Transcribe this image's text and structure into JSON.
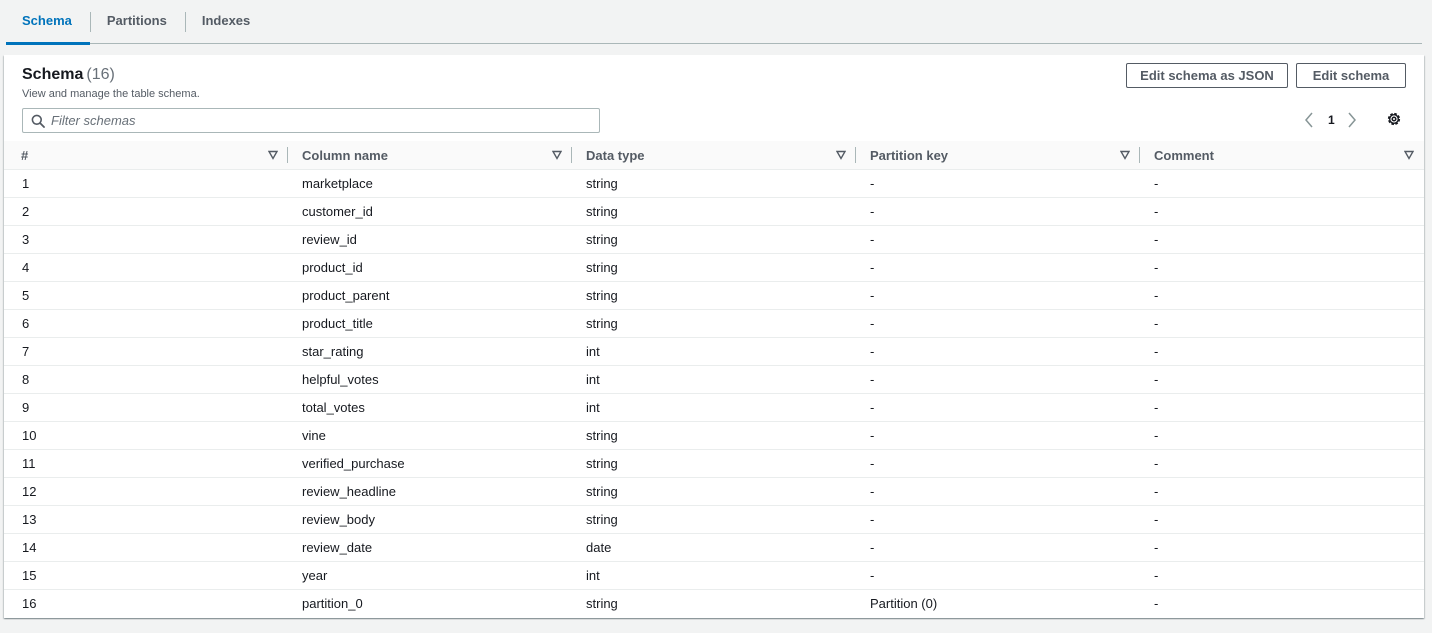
{
  "tabs": [
    {
      "label": "Schema",
      "active": true
    },
    {
      "label": "Partitions",
      "active": false
    },
    {
      "label": "Indexes",
      "active": false
    }
  ],
  "panel": {
    "title": "Schema",
    "count": "(16)",
    "description": "View and manage the table schema.",
    "edit_json_label": "Edit schema as JSON",
    "edit_label": "Edit schema",
    "filter_placeholder": "Filter schemas",
    "page": "1"
  },
  "columns": [
    "#",
    "Column name",
    "Data type",
    "Partition key",
    "Comment"
  ],
  "rows": [
    [
      "1",
      "marketplace",
      "string",
      "-",
      "-"
    ],
    [
      "2",
      "customer_id",
      "string",
      "-",
      "-"
    ],
    [
      "3",
      "review_id",
      "string",
      "-",
      "-"
    ],
    [
      "4",
      "product_id",
      "string",
      "-",
      "-"
    ],
    [
      "5",
      "product_parent",
      "string",
      "-",
      "-"
    ],
    [
      "6",
      "product_title",
      "string",
      "-",
      "-"
    ],
    [
      "7",
      "star_rating",
      "int",
      "-",
      "-"
    ],
    [
      "8",
      "helpful_votes",
      "int",
      "-",
      "-"
    ],
    [
      "9",
      "total_votes",
      "int",
      "-",
      "-"
    ],
    [
      "10",
      "vine",
      "string",
      "-",
      "-"
    ],
    [
      "11",
      "verified_purchase",
      "string",
      "-",
      "-"
    ],
    [
      "12",
      "review_headline",
      "string",
      "-",
      "-"
    ],
    [
      "13",
      "review_body",
      "string",
      "-",
      "-"
    ],
    [
      "14",
      "review_date",
      "date",
      "-",
      "-"
    ],
    [
      "15",
      "year",
      "int",
      "-",
      "-"
    ],
    [
      "16",
      "partition_0",
      "string",
      "Partition (0)",
      "-"
    ]
  ],
  "icons": {
    "search": "search-icon",
    "sort": "sort-down-triangle-icon",
    "prev": "chevron-left-icon",
    "next": "chevron-right-icon",
    "settings": "gear-icon"
  },
  "colors": {
    "accent": "#0073bb",
    "text": "#16191f",
    "muted": "#545b64",
    "border": "#aab7b8"
  }
}
